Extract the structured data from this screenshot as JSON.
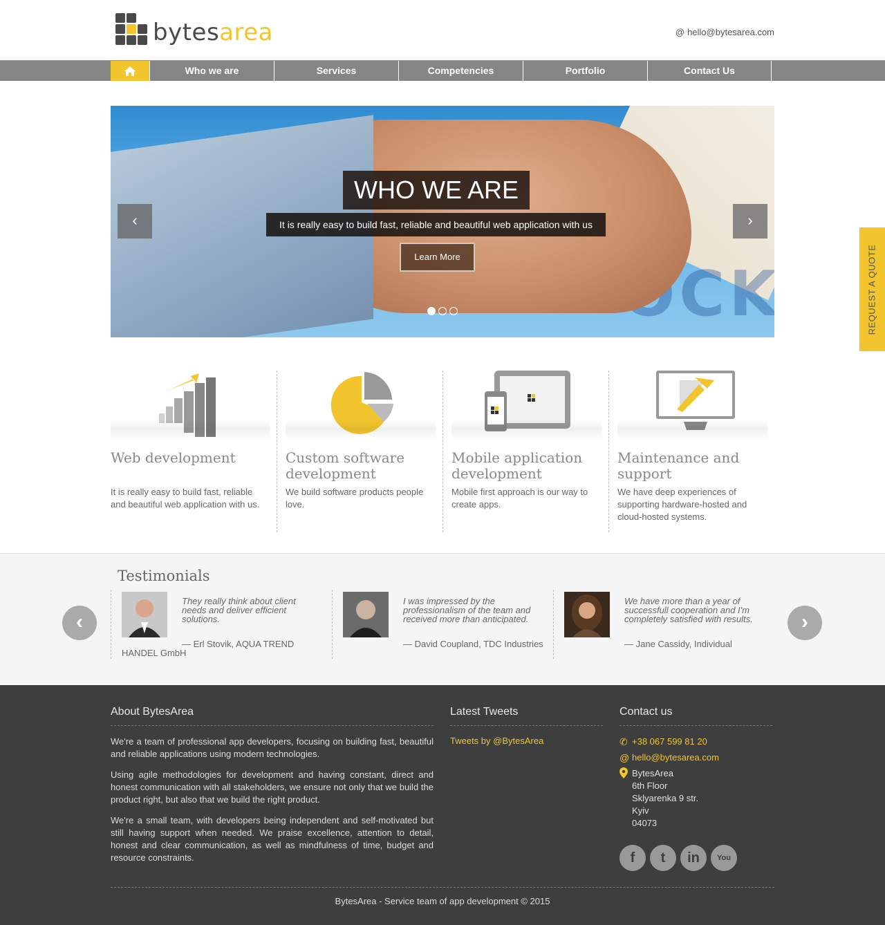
{
  "brand": {
    "name_part1": "bytes",
    "name_part2": "area",
    "accent": "#f2c52e"
  },
  "header": {
    "email_icon": "at-icon",
    "email": "hello@bytesarea.com"
  },
  "nav": {
    "home_icon": "home-icon",
    "items": [
      {
        "label": "Who we are"
      },
      {
        "label": "Services"
      },
      {
        "label": "Competencies"
      },
      {
        "label": "Portfolio"
      },
      {
        "label": "Contact Us"
      }
    ]
  },
  "hero": {
    "title": "WHO WE ARE",
    "subtitle": "It is really easy to build fast, reliable and beautiful web application with us",
    "button": "Learn More",
    "background_letters": "OCK",
    "prev_icon": "chevron-left-icon",
    "next_icon": "chevron-right-icon",
    "slides": 3,
    "active_slide": 1
  },
  "features": [
    {
      "icon": "growth-chart-icon",
      "title": "Web development",
      "text": "It is really easy to build fast, reliable and beautiful web application with us."
    },
    {
      "icon": "pie-chart-icon",
      "title": "Custom software development",
      "text": "We build software products people love."
    },
    {
      "icon": "mobile-tablet-icon",
      "title": "Mobile application development",
      "text": "Mobile first approach is our way to create apps."
    },
    {
      "icon": "monitor-tools-icon",
      "title": "Maintenance and support",
      "text": "We have deep experiences of supporting hardware-hosted and cloud-hosted systems."
    }
  ],
  "testimonials": {
    "title": "Testimonials",
    "items": [
      {
        "quote": "They really think about client needs and deliver efficient solutions.",
        "author": "— Erl Stovik, AQUA TREND HANDEL GmbH"
      },
      {
        "quote": "I was impressed by the professionalism of the team and received more than anticipated.",
        "author": "— David Coupland, TDC Industries"
      },
      {
        "quote": "We have more than a year of successfull cooperation and I'm completely satisfied with results.",
        "author": "— Jane Cassidy, Individual"
      }
    ]
  },
  "footer": {
    "about_title": "About BytesArea",
    "about_paragraphs": [
      "We're a team of professional app developers, focusing on building fast, beautiful and reliable applications using modern technologies.",
      "Using agile methodologies for development and having constant, direct and honest communication with all stakeholders, we ensure not only that we build the product right, but also that we build the right product.",
      "We're a small team, with developers being independent and self-motivated but still having support when needed. We praise excellence, attention to detail, honest and clear communication, as well as mindfulness of time, budget and resource constraints."
    ],
    "tweets_title": "Latest Tweets",
    "tweets_link": "Tweets by @BytesArea",
    "contact_title": "Contact us",
    "phone": "+38 067 599 81 20",
    "email": "hello@bytesarea.com",
    "address": [
      "BytesArea",
      "6th Floor",
      "Sklyarenka 9 str.",
      "Kyiv",
      "04073"
    ],
    "social": [
      "facebook-icon",
      "twitter-icon",
      "linkedin-icon",
      "youtube-icon"
    ],
    "copyright": "BytesArea - Service team of app development © 2015"
  },
  "quote_tab": "REQUEST A QUOTE"
}
